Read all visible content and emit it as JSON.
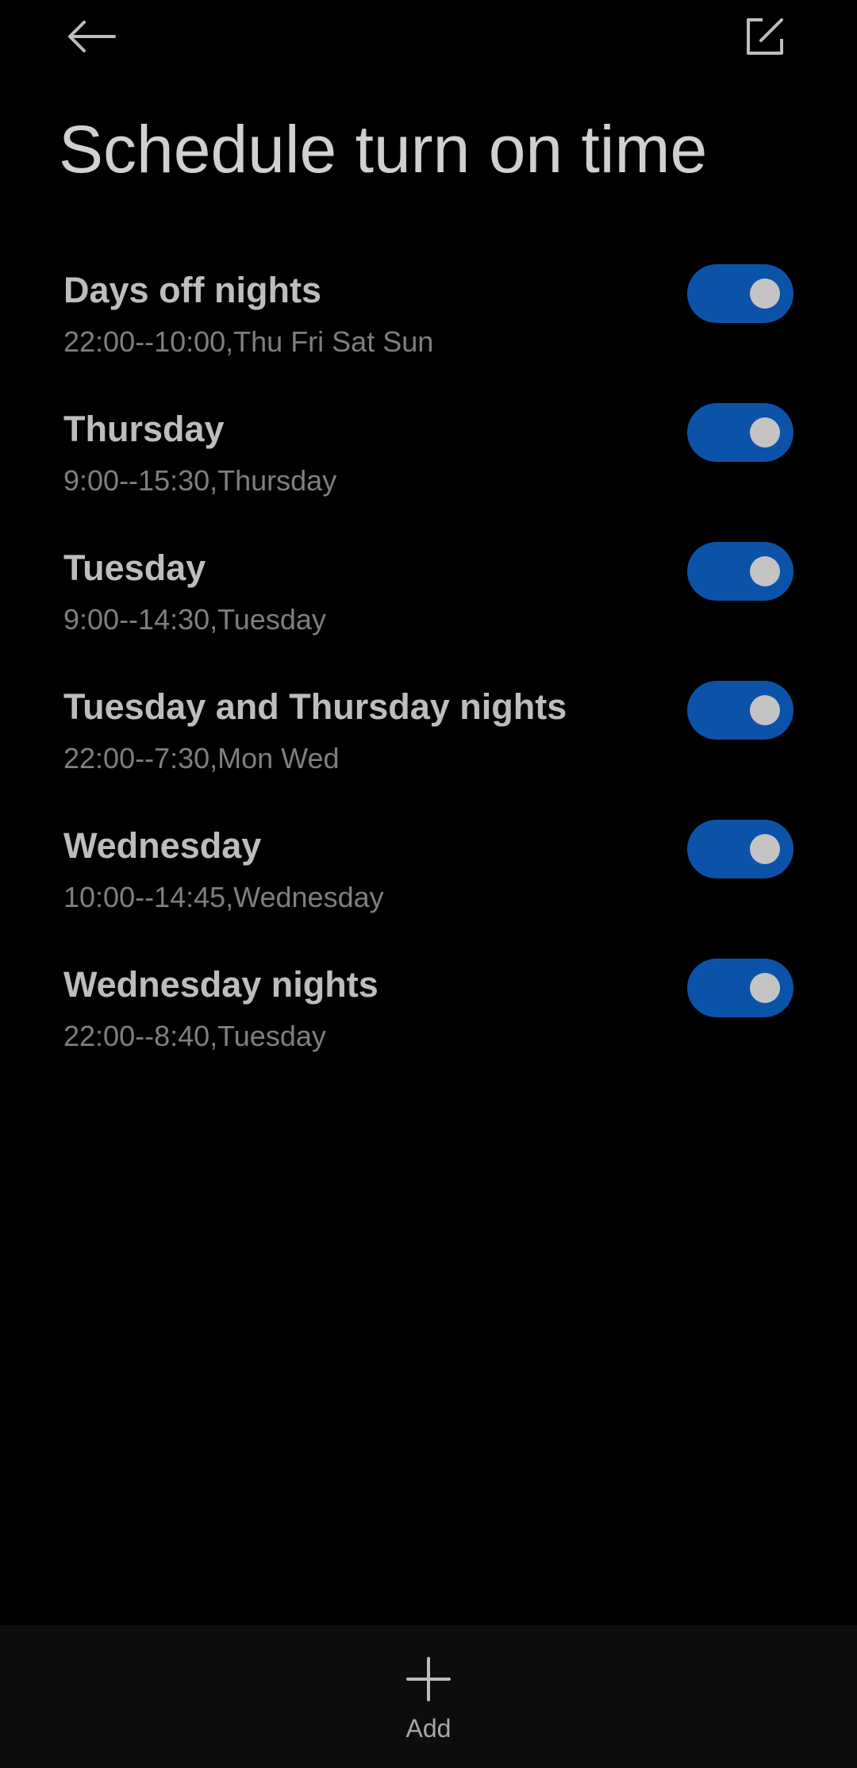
{
  "header": {
    "back_icon": "arrow-left-icon",
    "edit_icon": "edit-square-icon",
    "title": "Schedule turn on time"
  },
  "schedules": [
    {
      "title": "Days off nights",
      "subtitle": "22:00--10:00,Thu Fri Sat Sun",
      "enabled": true
    },
    {
      "title": "Thursday",
      "subtitle": "9:00--15:30,Thursday",
      "enabled": true
    },
    {
      "title": "Tuesday",
      "subtitle": "9:00--14:30,Tuesday",
      "enabled": true
    },
    {
      "title": "Tuesday and Thursday nights",
      "subtitle": "22:00--7:30,Mon Wed",
      "enabled": true
    },
    {
      "title": "Wednesday",
      "subtitle": "10:00--14:45,Wednesday",
      "enabled": true
    },
    {
      "title": "Wednesday nights",
      "subtitle": "22:00--8:40,Tuesday",
      "enabled": true
    }
  ],
  "footer": {
    "add_icon": "plus-icon",
    "add_label": "Add"
  },
  "colors": {
    "background": "#000000",
    "toggle_on": "#0a53a8",
    "footer_bg": "#0d0d0d"
  }
}
